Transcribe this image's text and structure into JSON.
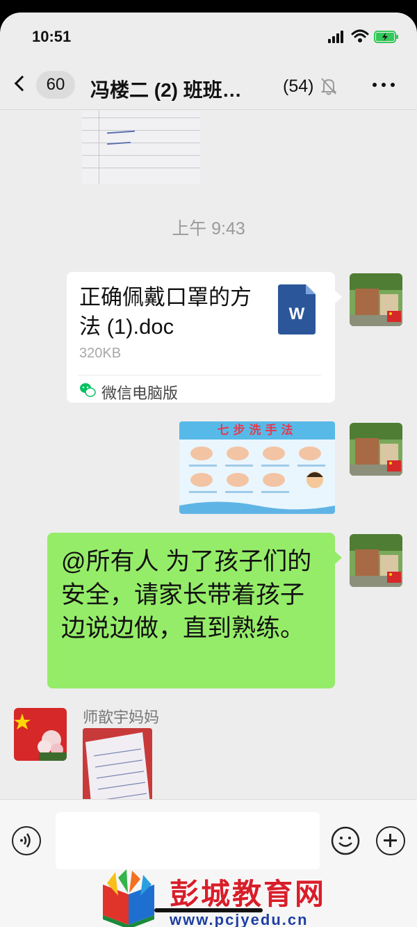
{
  "status_bar": {
    "time": "10:51"
  },
  "nav": {
    "back_count": "60",
    "title": "冯楼二 (2) 班班…",
    "member_count": "(54)",
    "icons": [
      "chevron-left-icon",
      "mute-bell-icon",
      "more-icon"
    ]
  },
  "chat": {
    "timestamp": "上午 9:43",
    "file_message": {
      "name": "正确佩戴口罩的方法 (1).doc",
      "size": "320KB",
      "source": "微信电脑版",
      "file_icon_letter": "W",
      "file_icon_color": "#2b579a"
    },
    "poster": {
      "title": "七步洗手法"
    },
    "text_message": {
      "text": "@所有人 为了孩子们的安全，请家长带着孩子边说边做，直到熟练。",
      "bubble_color": "#95ec69"
    },
    "incoming": {
      "sender": "师歆宇妈妈"
    }
  },
  "input_bar": {
    "icons": [
      "voice-icon",
      "emoji-icon",
      "plus-icon"
    ]
  },
  "watermark": {
    "title": "彭城教育网",
    "url": "www.pcjyedu.cn"
  }
}
